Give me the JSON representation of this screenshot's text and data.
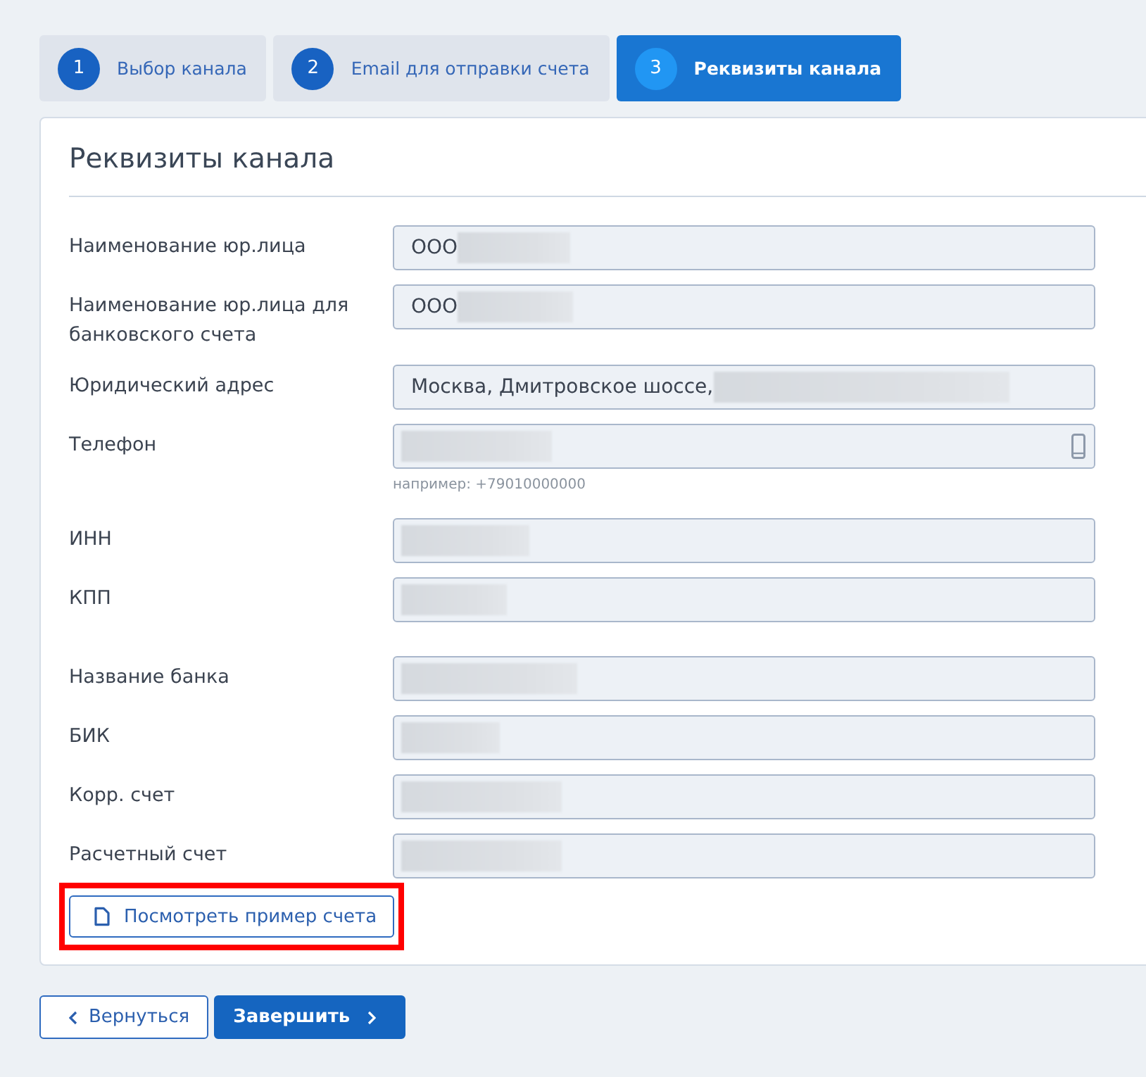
{
  "steps": [
    {
      "number": "1",
      "label": "Выбор канала",
      "selected": false
    },
    {
      "number": "2",
      "label": "Email для отправки счета",
      "selected": false
    },
    {
      "number": "3",
      "label": "Реквизиты канала",
      "selected": true
    }
  ],
  "card": {
    "title": "Реквизиты канала",
    "sections": [
      {
        "fields": [
          {
            "label": "Наименование юр.лица",
            "kind": "text",
            "value": "ООО",
            "redacted": true
          },
          {
            "label": "Наименование юр.лица для банковского счета",
            "kind": "text",
            "value": "ООО",
            "redacted": true
          },
          {
            "label": "Юридический адрес",
            "kind": "text",
            "value": "Москва, Дмитровское шоссе,",
            "redacted": true
          },
          {
            "label": "Телефон",
            "kind": "phone",
            "redacted": true,
            "hint": "например: +79010000000"
          },
          {
            "label": "ИНН",
            "kind": "text",
            "redacted": true
          },
          {
            "label": "КПП",
            "kind": "text",
            "redacted": true
          }
        ]
      },
      {
        "fields": [
          {
            "label": "Название банка",
            "kind": "text",
            "redacted": true
          },
          {
            "label": "БИК",
            "kind": "text",
            "redacted": true
          },
          {
            "label": "Корр. счет",
            "kind": "text",
            "redacted": true
          },
          {
            "label": "Расчетный счет",
            "kind": "text",
            "redacted": true
          }
        ]
      }
    ],
    "example_button": {
      "label": "Посмотреть пример счета",
      "highlighted": true
    }
  },
  "footer": {
    "buttons": [
      {
        "label": "Вернуться",
        "kind": "back"
      },
      {
        "label": "Завершить",
        "kind": "next"
      }
    ]
  }
}
